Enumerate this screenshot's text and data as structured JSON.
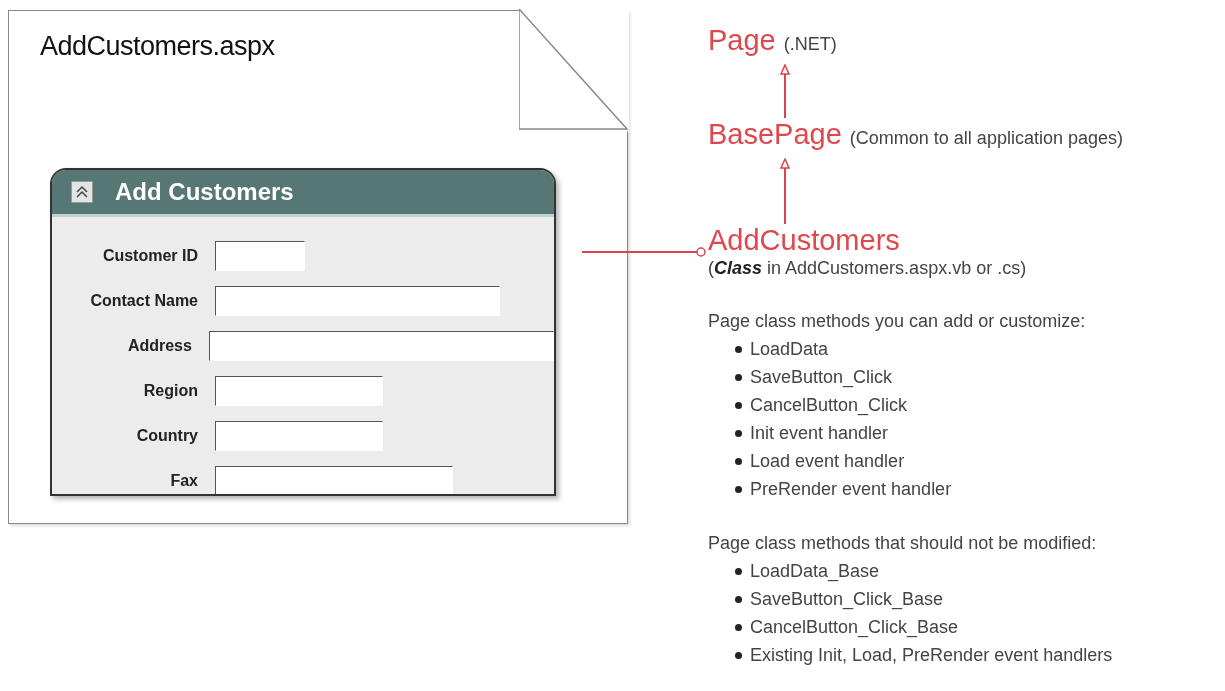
{
  "document": {
    "filename": "AddCustomers.aspx",
    "form": {
      "title": "Add Customers",
      "fields": [
        {
          "label": "Customer ID"
        },
        {
          "label": "Contact Name"
        },
        {
          "label": "Address"
        },
        {
          "label": "Region"
        },
        {
          "label": "Country"
        },
        {
          "label": "Fax"
        }
      ]
    }
  },
  "hierarchy": [
    {
      "name": "Page",
      "note": "(.NET)"
    },
    {
      "name": "BasePage",
      "note": "(Common to all application pages)"
    },
    {
      "name": "AddCustomers",
      "note": "(**Class** in AddCustomers.aspx.vb or .cs)"
    }
  ],
  "method_groups": [
    {
      "heading": "Page class methods you can add or customize:",
      "items": [
        "LoadData",
        "SaveButton_Click",
        "CancelButton_Click",
        "Init event handler",
        "Load event handler",
        "PreRender event handler"
      ]
    },
    {
      "heading": "Page class methods that should not be modified:",
      "items": [
        "LoadData_Base",
        "SaveButton_Click_Base",
        "CancelButton_Click_Base",
        "Existing Init, Load, PreRender event handlers"
      ]
    }
  ]
}
